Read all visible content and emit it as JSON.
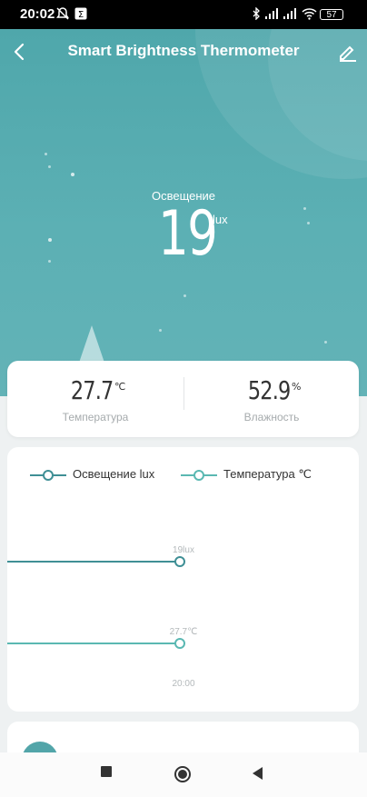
{
  "status_bar": {
    "time": "20:02",
    "battery": "57"
  },
  "header": {
    "title": "Smart Brightness Thermometer",
    "icons": [
      "back-arrow-icon",
      "edit-pencil-icon"
    ]
  },
  "hero": {
    "label": "Освещение",
    "value": "19",
    "unit": "lux"
  },
  "stats": {
    "temperature": {
      "value": "27.7",
      "unit": "℃",
      "label": "Температура"
    },
    "humidity": {
      "value": "52.9",
      "unit": "%",
      "label": "Влажность"
    }
  },
  "chart_data": {
    "type": "line",
    "legend": [
      "Освещение lux",
      "Температура ℃"
    ],
    "series": [
      {
        "name": "Освещение lux",
        "points": [
          {
            "x": "20:00",
            "y": 19
          }
        ],
        "label": "19lux"
      },
      {
        "name": "Температура ℃",
        "points": [
          {
            "x": "20:00",
            "y": 27.7
          }
        ],
        "label": "27.7℃"
      }
    ],
    "x_tick": "20:00",
    "colors": {
      "lux": "#3f8f95",
      "temp": "#5ab8b2"
    }
  },
  "colors": {
    "accent": "#52a5a9",
    "hero_bg": "#56acb0"
  }
}
